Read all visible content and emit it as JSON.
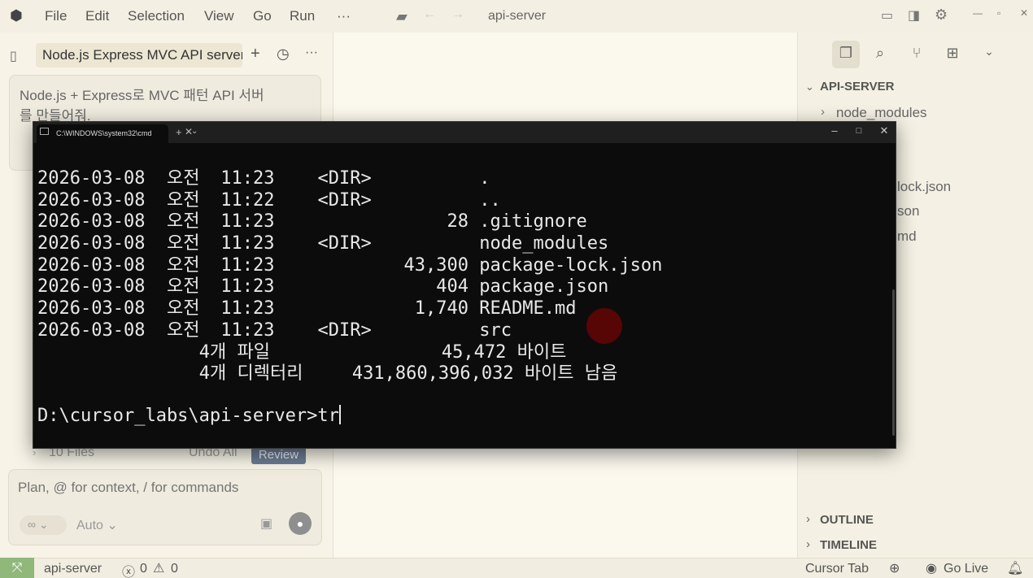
{
  "titlebar": {
    "menu": [
      "File",
      "Edit",
      "Selection",
      "View",
      "Go",
      "Run",
      "···"
    ],
    "window_title": "api-server"
  },
  "chat": {
    "tab_label": "Node.js Express MVC API server s",
    "prompt_text_line1": "Node.js + Express로 MVC 패턴 API 서버",
    "prompt_text_line2": "를 만들어줘.",
    "files_count": "10 Files",
    "undo_all": "Undo All",
    "review": "Review",
    "composer_placeholder": "Plan, @ for context, / for commands",
    "mode_symbol": "∞ ⌄",
    "model": "Auto ⌄"
  },
  "explorer": {
    "header": "API-SERVER",
    "items": [
      "node_modules",
      "lock.json",
      "son",
      "md"
    ],
    "outline": "OUTLINE",
    "timeline": "TIMELINE"
  },
  "statusbar": {
    "branch": "api-server",
    "errors": "0",
    "warnings": "0",
    "cursor_tab": "Cursor Tab",
    "go_live": "Go Live"
  },
  "terminal": {
    "tab_title": "C:\\WINDOWS\\system32\\cmd",
    "rows": [
      {
        "date": "2026-03-08",
        "ampm": "오전",
        "time": "11:23",
        "dir": "<DIR>",
        "size": "",
        "name": "."
      },
      {
        "date": "2026-03-08",
        "ampm": "오전",
        "time": "11:22",
        "dir": "<DIR>",
        "size": "",
        "name": ".."
      },
      {
        "date": "2026-03-08",
        "ampm": "오전",
        "time": "11:23",
        "dir": "",
        "size": "28",
        "name": ".gitignore"
      },
      {
        "date": "2026-03-08",
        "ampm": "오전",
        "time": "11:23",
        "dir": "<DIR>",
        "size": "",
        "name": "node_modules"
      },
      {
        "date": "2026-03-08",
        "ampm": "오전",
        "time": "11:23",
        "dir": "",
        "size": "43,300",
        "name": "package-lock.json"
      },
      {
        "date": "2026-03-08",
        "ampm": "오전",
        "time": "11:23",
        "dir": "",
        "size": "404",
        "name": "package.json"
      },
      {
        "date": "2026-03-08",
        "ampm": "오전",
        "time": "11:23",
        "dir": "",
        "size": "1,740",
        "name": "README.md"
      },
      {
        "date": "2026-03-08",
        "ampm": "오전",
        "time": "11:23",
        "dir": "<DIR>",
        "size": "",
        "name": "src"
      }
    ],
    "summary_files": "4개 파일",
    "summary_files_bytes": "45,472 바이트",
    "summary_dirs": "4개 디렉터리",
    "summary_dirs_bytes": "431,860,396,032 바이트 남음",
    "prompt": "D:\\cursor_labs\\api-server>tr"
  }
}
